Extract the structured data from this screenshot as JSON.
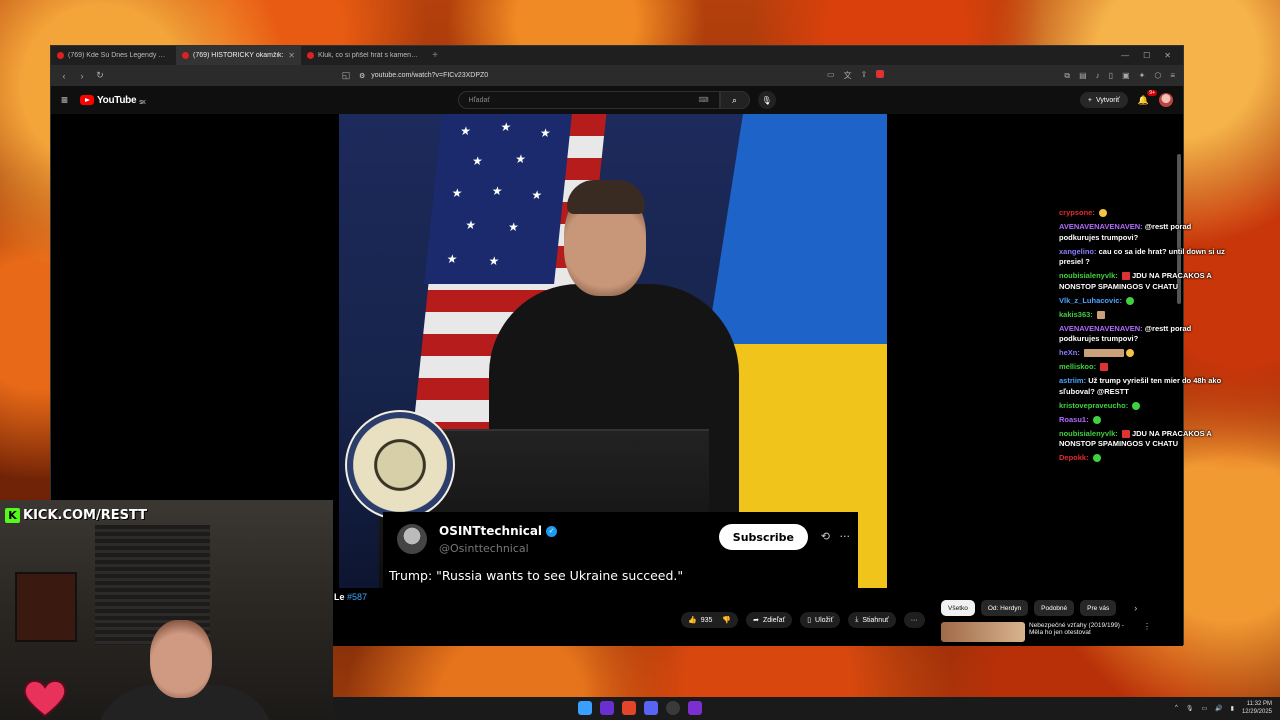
{
  "browser": {
    "tabs": [
      {
        "title": "(769) Kde Sú Dnes Legendy Českosl",
        "active": false
      },
      {
        "title": "(769) HISTORICKÝ okamžik: ",
        "active": true
      },
      {
        "title": "Kluk, co si přišel hrát s kamenem se ",
        "active": false
      }
    ],
    "url": "youtube.com/watch?v=FICv23XDPZ0"
  },
  "youtube": {
    "logo": "YouTube",
    "country": "SK",
    "search_placeholder": "Hľadať",
    "create_label": "Vytvoriť",
    "notif_count": "9+"
  },
  "video": {
    "tweet_name": "OSINTtechnical",
    "tweet_handle": "@Osinttechnical",
    "tweet_subscribe": "Subscribe",
    "tweet_text": "Trump: \"Russia wants to see Ukraine succeed.\"",
    "title_prefix": "Le",
    "title_hashtag": "#587",
    "likes": "935",
    "share_label": "Zdieľať",
    "save_label": "Uložiť",
    "download_label": "Stiahnuť"
  },
  "chips": [
    "Všetko",
    "Od: Herdyn",
    "Podobné",
    "Pre vás"
  ],
  "recommendation": {
    "title": "Nebezpečné vzťahy (2019/199) - Měla ho jen otestovat"
  },
  "chat": [
    {
      "user": "crypsone:",
      "color": "#e02b2b",
      "text": ""
    },
    {
      "user": "AVENAVENAVENAVEN:",
      "color": "#b36bff",
      "text": "@restt porad podkurujes trumpovi?"
    },
    {
      "user": "xangelino:",
      "color": "#8a7dff",
      "text": "cau co sa ide hrat? until down si uz presiel ?"
    },
    {
      "user": "noubisialenyvlk:",
      "color": "#3fd13f",
      "text": "JDU NA PRACAKOS A NONSTOP SPAMINGOS V CHATU"
    },
    {
      "user": "Vlk_z_Luhacovic:",
      "color": "#4aa3ff",
      "text": ""
    },
    {
      "user": "kakis363:",
      "color": "#3fd13f",
      "text": ""
    },
    {
      "user": "AVENAVENAVENAVEN:",
      "color": "#b36bff",
      "text": "@restt porad podkurujes trumpovi?"
    },
    {
      "user": "heXn:",
      "color": "#8a7dff",
      "text": ""
    },
    {
      "user": "melliskoo:",
      "color": "#3fd13f",
      "text": ""
    },
    {
      "user": "astriim:",
      "color": "#4aa3ff",
      "text": "Už trump vyriešil ten mier do 48h ako sľuboval? @RESTT"
    },
    {
      "user": "kristovepraveucho:",
      "color": "#3fd13f",
      "text": ""
    },
    {
      "user": "Roasu1:",
      "color": "#b36bff",
      "text": ""
    },
    {
      "user": "noubisialenyvlk:",
      "color": "#3fd13f",
      "text": "JDU NA PRACAKOS A NONSTOP SPAMINGOS V CHATU"
    },
    {
      "user": "Depokk:",
      "color": "#e02b2b",
      "text": ""
    }
  ],
  "overlay": {
    "kick_url": "KICK.COM/RESTT"
  },
  "taskbar": {
    "time": "11:32 PM",
    "date": "12/29/2025"
  }
}
